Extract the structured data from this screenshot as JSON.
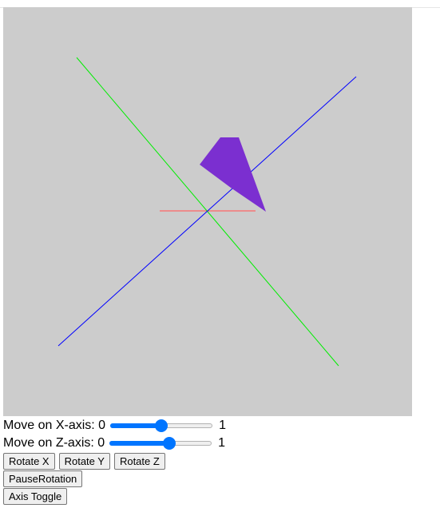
{
  "scene": {
    "background": "#cccccc",
    "axis_colors": {
      "x": "#ff0000",
      "y": "#00ff00",
      "z": "#0000ff"
    },
    "shape_color": "#7b2fd0"
  },
  "controls": {
    "move_x": {
      "label": "Move on X-axis: ",
      "min": "0",
      "max": "1",
      "value": 0.5
    },
    "move_z": {
      "label": "Move on Z-axis: ",
      "min": "0",
      "max": "1",
      "value": 0.6
    }
  },
  "buttons": {
    "rotate_x": "Rotate X",
    "rotate_y": "Rotate Y",
    "rotate_z": "Rotate Z",
    "pause": "PauseRotation",
    "axis_toggle": "Axis Toggle"
  }
}
